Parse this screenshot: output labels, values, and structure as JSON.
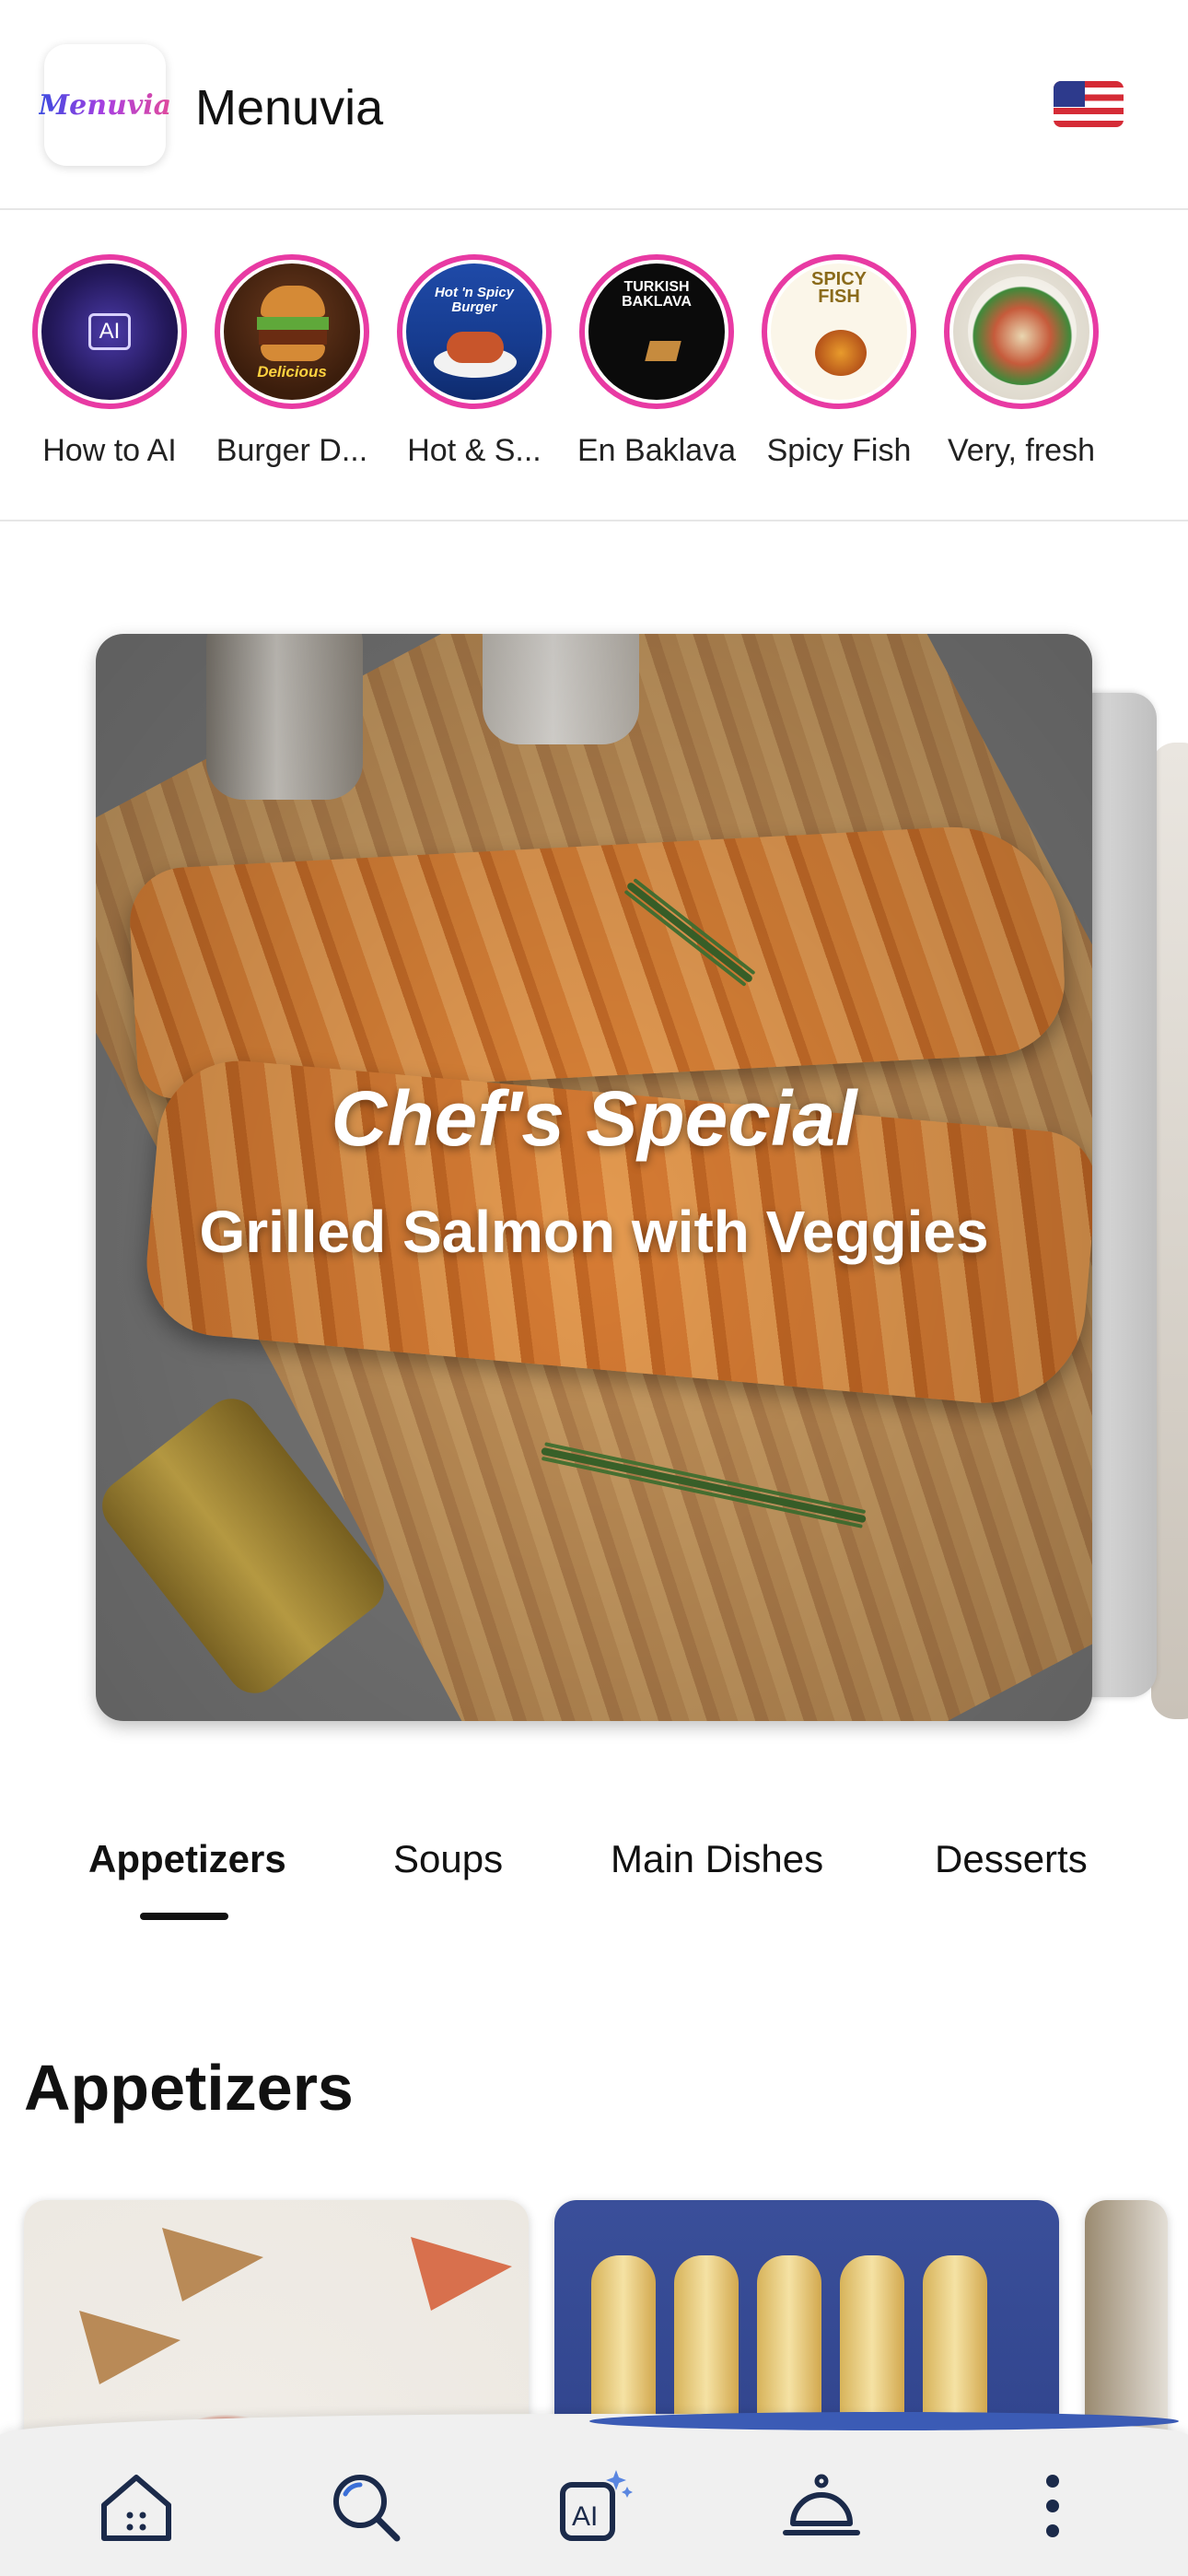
{
  "header": {
    "logo_text": "Menuvia",
    "app_title": "Menuvia",
    "language_flag": "us-flag-icon"
  },
  "stories": [
    {
      "label": "How to AI"
    },
    {
      "label": "Burger D..."
    },
    {
      "label": "Hot & S..."
    },
    {
      "label": "En Baklava"
    },
    {
      "label": "Spicy Fish"
    },
    {
      "label": "Very, fresh"
    }
  ],
  "hero": {
    "title": "Chef's Special",
    "subtitle": "Grilled Salmon with Veggies"
  },
  "tabs": [
    {
      "label": "Appetizers",
      "active": true
    },
    {
      "label": "Soups",
      "active": false
    },
    {
      "label": "Main Dishes",
      "active": false
    },
    {
      "label": "Desserts",
      "active": false
    }
  ],
  "section": {
    "title": "Appetizers"
  },
  "bottom_nav": [
    {
      "icon": "home-icon"
    },
    {
      "icon": "search-icon"
    },
    {
      "icon": "ai-sparkle-icon"
    },
    {
      "icon": "service-bell-icon"
    },
    {
      "icon": "more-vertical-icon"
    }
  ],
  "colors": {
    "accent_ring": "#e83aa3",
    "nav_indicator": "#3b5bb5"
  }
}
